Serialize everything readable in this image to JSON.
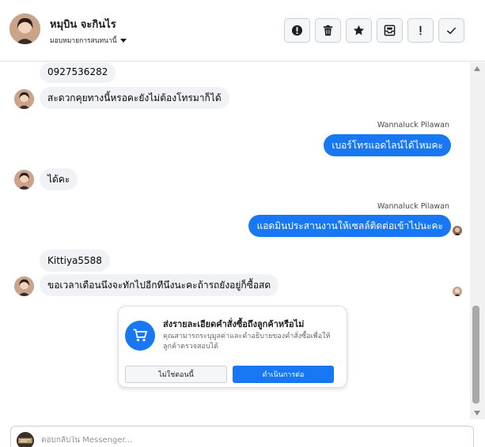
{
  "contact": {
    "name": "หมุบิน จะกินไร",
    "assign_label": "มอบหมายการสนทนานี้",
    "avatar_icon": "profile-photo"
  },
  "toolbar": {
    "buttons": [
      {
        "icon": "alert-circle-icon"
      },
      {
        "icon": "trash-icon"
      },
      {
        "icon": "star-icon"
      },
      {
        "icon": "archive-icon"
      },
      {
        "icon": "exclamation-icon"
      },
      {
        "icon": "checkmark-icon"
      }
    ]
  },
  "messages": [
    {
      "text": "0927536282"
    },
    {
      "text": "สะดวกคุยทางนี้หรอคะยังไม่ต้องโทรมาก็ได้"
    },
    {
      "sender": "Wannaluck Pilawan",
      "text": "เบอร์โทรแอดไลน์ได้ไหมคะ"
    },
    {
      "text": "ได้คะ"
    },
    {
      "sender": "Wannaluck Pilawan",
      "text": "แอดมินประสานงานให้เซลล์ติดต่อเข้าไปนะคะ"
    },
    {
      "text": "Kittiya5588"
    },
    {
      "text": "ขอเวลาเดือนนึงจะทักไปอีกทีนึงนะคะถ้ารถยังอยู่ก็ซื้อสด"
    }
  ],
  "order_card": {
    "title": "ส่งรายละเอียดคำสั่งซื้อถึงลูกค้าหรือไม่",
    "body": "คุณสามารถระบุมูลค่าและคำอธิบายของคำสั่งซื้อเพื่อให้ลูกค้าตรวจสอบได้",
    "secondary_button": "ไม่ใช่ตอนนี้",
    "primary_button": "ดำเนินการต่อ",
    "icon": "shopping-cart-icon"
  },
  "composer": {
    "placeholder": "ตอบกลับใน Messenger..."
  },
  "colors": {
    "accent": "#1877f2",
    "incoming_bubble": "#f0f2f5"
  }
}
